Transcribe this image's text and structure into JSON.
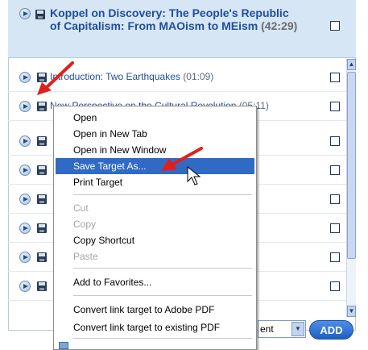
{
  "header": {
    "title": "Koppel on Discovery: The People's Republic of Capitalism: From MAOism to MEism",
    "duration": "(42:29)"
  },
  "items": [
    {
      "label": "Introduction: Two Earthquakes",
      "duration": "(01:09)"
    },
    {
      "label": "New Perspective on the Cultural Revolution",
      "duration": "(05:11)"
    },
    {
      "label": "",
      "duration": ""
    },
    {
      "label": "",
      "duration": ""
    },
    {
      "label": "",
      "duration": ""
    },
    {
      "label": "",
      "duration": ""
    },
    {
      "label": "",
      "duration": ""
    },
    {
      "label": "",
      "duration": ""
    }
  ],
  "menu": {
    "items": [
      {
        "label": "Open"
      },
      {
        "label": "Open in New Tab"
      },
      {
        "label": "Open in New Window"
      },
      {
        "label": "Save Target As...",
        "highlighted": true
      },
      {
        "label": "Print Target"
      },
      {
        "label": "Cut",
        "disabled": true
      },
      {
        "label": "Copy",
        "disabled": true
      },
      {
        "label": "Copy Shortcut"
      },
      {
        "label": "Paste",
        "disabled": true
      },
      {
        "label": "Add to Favorites..."
      },
      {
        "label": "Convert link target to Adobe PDF"
      },
      {
        "label": "Convert link target to existing PDF"
      }
    ]
  },
  "bottom": {
    "dropdown_value": "ent",
    "add_label": "ADD"
  },
  "colors": {
    "highlight": "#316ac5",
    "link": "#1f4e9b",
    "annotation": "#e0201b"
  }
}
